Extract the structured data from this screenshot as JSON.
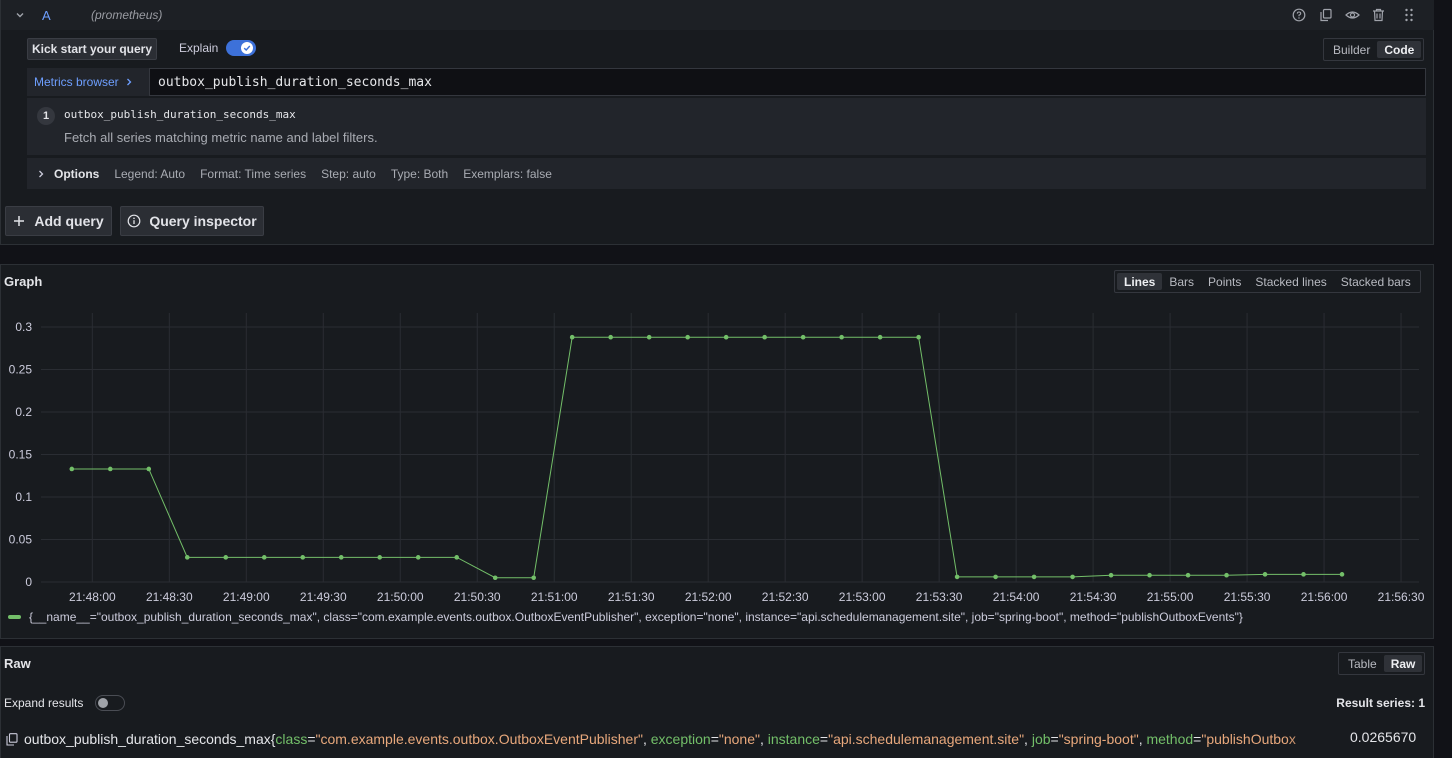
{
  "query_row": {
    "ref_id": "A",
    "datasource": "(prometheus)",
    "icons": [
      "help-icon",
      "duplicate-icon",
      "eye-icon",
      "trash-icon",
      "drag-icon"
    ]
  },
  "toolbar": {
    "kick_start_label": "Kick start your query",
    "explain_label": "Explain",
    "explain_on": true,
    "builder_label": "Builder",
    "code_label": "Code"
  },
  "editor": {
    "metrics_browser_label": "Metrics browser",
    "query": "outbox_publish_duration_seconds_max",
    "explain_step_number": "1",
    "explain_step_query": "outbox_publish_duration_seconds_max",
    "explain_step_description": "Fetch all series matching metric name and label filters."
  },
  "options": {
    "title": "Options",
    "legend": "Legend: Auto",
    "format": "Format: Time series",
    "step": "Step: auto",
    "type": "Type: Both",
    "exemplars": "Exemplars: false"
  },
  "actions": {
    "add_query_label": "Add query",
    "query_inspector_label": "Query inspector"
  },
  "graph": {
    "title": "Graph",
    "modes": [
      "Lines",
      "Bars",
      "Points",
      "Stacked lines",
      "Stacked bars"
    ],
    "active_mode": "Lines",
    "series_color": "#73bf69",
    "legend_text": "{__name__=\"outbox_publish_duration_seconds_max\", class=\"com.example.events.outbox.OutboxEventPublisher\", exception=\"none\", instance=\"api.schedulemanagement.site\", job=\"spring-boot\", method=\"publishOutboxEvents\"}"
  },
  "chart_data": {
    "type": "line",
    "y_ticks": [
      "0",
      "0.05",
      "0.1",
      "0.15",
      "0.2",
      "0.25",
      "0.3"
    ],
    "ylim": [
      0,
      0.3
    ],
    "x_ticks": [
      "21:48:00",
      "21:48:30",
      "21:49:00",
      "21:49:30",
      "21:50:00",
      "21:50:30",
      "21:51:00",
      "21:51:30",
      "21:52:00",
      "21:52:30",
      "21:53:00",
      "21:53:30",
      "21:54:00",
      "21:54:30",
      "21:55:00",
      "21:55:30",
      "21:56:00",
      "21:56:30"
    ],
    "x_unit_note": "x values are timestamps as seconds past 21:47:00",
    "grid": true,
    "series": [
      {
        "x": [
          52,
          67,
          82,
          97,
          112,
          127,
          142,
          157,
          172,
          187,
          202,
          217,
          232,
          247,
          262,
          277,
          292,
          307,
          322,
          337,
          352,
          367,
          382,
          397,
          412,
          427,
          442,
          457,
          472,
          487,
          502,
          517,
          532,
          547
        ],
        "y": [
          0.133,
          0.133,
          0.133,
          0.029,
          0.029,
          0.029,
          0.029,
          0.029,
          0.029,
          0.029,
          0.029,
          0.005,
          0.005,
          0.288,
          0.288,
          0.288,
          0.288,
          0.288,
          0.288,
          0.288,
          0.288,
          0.288,
          0.288,
          0.006,
          0.006,
          0.006,
          0.006,
          0.008,
          0.008,
          0.008,
          0.008,
          0.009,
          0.009,
          0.009
        ]
      }
    ]
  },
  "raw": {
    "title": "Raw",
    "table_label": "Table",
    "raw_label": "Raw",
    "expand_label": "Expand results",
    "result_series": "Result series: 1",
    "metric_name": "outbox_publish_duration_seconds_max",
    "labels": [
      {
        "key": "class",
        "value": "\"com.example.events.outbox.OutboxEventPublisher\""
      },
      {
        "key": "exception",
        "value": "\"none\""
      },
      {
        "key": "instance",
        "value": "\"api.schedulemanagement.site\""
      },
      {
        "key": "job",
        "value": "\"spring-boot\""
      },
      {
        "key": "method",
        "value": "\"publishOutbox"
      }
    ],
    "value": "0.0265670"
  }
}
